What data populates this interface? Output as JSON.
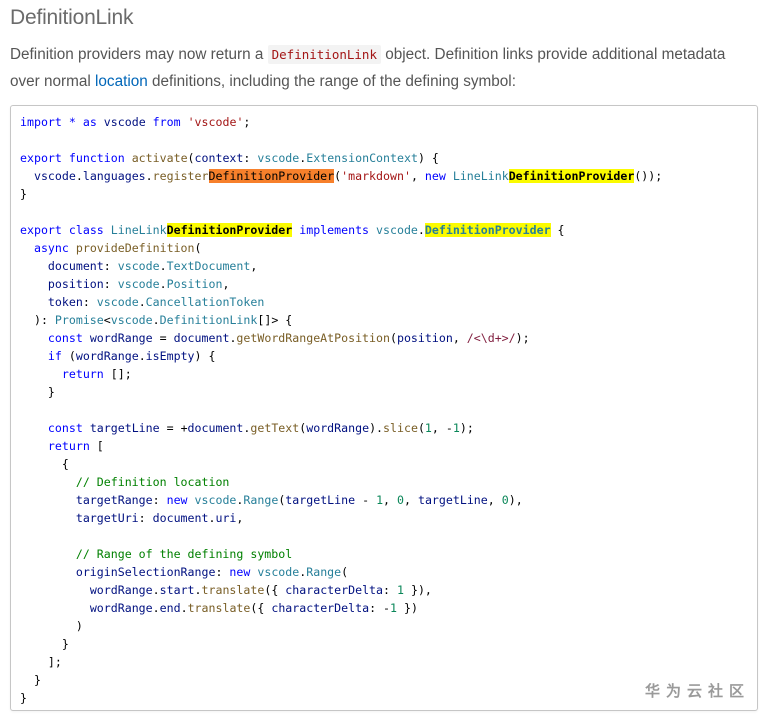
{
  "heading": "DefinitionLink",
  "intro": {
    "part1": "Definition providers may now return a ",
    "code": "DefinitionLink",
    "part2": " object. Definition links provide additional metadata over normal ",
    "link": "location",
    "part3": " definitions, including the range of the defining symbol:"
  },
  "code_lines": [
    [
      [
        "kw",
        "import"
      ],
      [
        "p",
        " "
      ],
      [
        "kw",
        "*"
      ],
      [
        "p",
        " "
      ],
      [
        "kw",
        "as"
      ],
      [
        "p",
        " "
      ],
      [
        "var",
        "vscode"
      ],
      [
        "p",
        " "
      ],
      [
        "kw",
        "from"
      ],
      [
        "p",
        " "
      ],
      [
        "str",
        "'vscode'"
      ],
      [
        "p",
        ";"
      ]
    ],
    [],
    [
      [
        "kw",
        "export"
      ],
      [
        "p",
        " "
      ],
      [
        "kw",
        "function"
      ],
      [
        "p",
        " "
      ],
      [
        "fn",
        "activate"
      ],
      [
        "p",
        "("
      ],
      [
        "var",
        "context"
      ],
      [
        "p",
        ": "
      ],
      [
        "ty",
        "vscode"
      ],
      [
        "p",
        "."
      ],
      [
        "ty",
        "ExtensionContext"
      ],
      [
        "p",
        ") {"
      ]
    ],
    [
      [
        "p",
        "  "
      ],
      [
        "var",
        "vscode"
      ],
      [
        "p",
        "."
      ],
      [
        "var",
        "languages"
      ],
      [
        "p",
        "."
      ],
      [
        "fn",
        "register"
      ],
      [
        "hl-o",
        "DefinitionProvider"
      ],
      [
        "p",
        "("
      ],
      [
        "str",
        "'markdown'"
      ],
      [
        "p",
        ", "
      ],
      [
        "kw",
        "new"
      ],
      [
        "p",
        " "
      ],
      [
        "ty",
        "LineLink"
      ],
      [
        "hl-y",
        "DefinitionProvider"
      ],
      [
        "p",
        "());"
      ]
    ],
    [
      [
        "p",
        "}"
      ]
    ],
    [],
    [
      [
        "kw",
        "export"
      ],
      [
        "p",
        " "
      ],
      [
        "kw",
        "class"
      ],
      [
        "p",
        " "
      ],
      [
        "ty",
        "LineLink"
      ],
      [
        "hl-y",
        "DefinitionProvider"
      ],
      [
        "p",
        " "
      ],
      [
        "kw",
        "implements"
      ],
      [
        "p",
        " "
      ],
      [
        "ty",
        "vscode"
      ],
      [
        "p",
        "."
      ],
      [
        "hl-ty",
        "DefinitionProvider"
      ],
      [
        "p",
        " {"
      ]
    ],
    [
      [
        "p",
        "  "
      ],
      [
        "kw",
        "async"
      ],
      [
        "p",
        " "
      ],
      [
        "fn",
        "provideDefinition"
      ],
      [
        "p",
        "("
      ]
    ],
    [
      [
        "p",
        "    "
      ],
      [
        "var",
        "document"
      ],
      [
        "p",
        ": "
      ],
      [
        "ty",
        "vscode"
      ],
      [
        "p",
        "."
      ],
      [
        "ty",
        "TextDocument"
      ],
      [
        "p",
        ","
      ]
    ],
    [
      [
        "p",
        "    "
      ],
      [
        "var",
        "position"
      ],
      [
        "p",
        ": "
      ],
      [
        "ty",
        "vscode"
      ],
      [
        "p",
        "."
      ],
      [
        "ty",
        "Position"
      ],
      [
        "p",
        ","
      ]
    ],
    [
      [
        "p",
        "    "
      ],
      [
        "var",
        "token"
      ],
      [
        "p",
        ": "
      ],
      [
        "ty",
        "vscode"
      ],
      [
        "p",
        "."
      ],
      [
        "ty",
        "CancellationToken"
      ]
    ],
    [
      [
        "p",
        "  ): "
      ],
      [
        "ty",
        "Promise"
      ],
      [
        "p",
        "<"
      ],
      [
        "ty",
        "vscode"
      ],
      [
        "p",
        "."
      ],
      [
        "ty",
        "DefinitionLink"
      ],
      [
        "p",
        "[]> {"
      ]
    ],
    [
      [
        "p",
        "    "
      ],
      [
        "kw",
        "const"
      ],
      [
        "p",
        " "
      ],
      [
        "var",
        "wordRange"
      ],
      [
        "p",
        " = "
      ],
      [
        "var",
        "document"
      ],
      [
        "p",
        "."
      ],
      [
        "fn",
        "getWordRangeAtPosition"
      ],
      [
        "p",
        "("
      ],
      [
        "var",
        "position"
      ],
      [
        "p",
        ", "
      ],
      [
        "re",
        "/<\\d+>/"
      ],
      [
        "p",
        ");"
      ]
    ],
    [
      [
        "p",
        "    "
      ],
      [
        "kw",
        "if"
      ],
      [
        "p",
        " ("
      ],
      [
        "var",
        "wordRange"
      ],
      [
        "p",
        "."
      ],
      [
        "var",
        "isEmpty"
      ],
      [
        "p",
        ") {"
      ]
    ],
    [
      [
        "p",
        "      "
      ],
      [
        "kw",
        "return"
      ],
      [
        "p",
        " [];"
      ]
    ],
    [
      [
        "p",
        "    }"
      ]
    ],
    [],
    [
      [
        "p",
        "    "
      ],
      [
        "kw",
        "const"
      ],
      [
        "p",
        " "
      ],
      [
        "var",
        "targetLine"
      ],
      [
        "p",
        " = +"
      ],
      [
        "var",
        "document"
      ],
      [
        "p",
        "."
      ],
      [
        "fn",
        "getText"
      ],
      [
        "p",
        "("
      ],
      [
        "var",
        "wordRange"
      ],
      [
        "p",
        ")."
      ],
      [
        "fn",
        "slice"
      ],
      [
        "p",
        "("
      ],
      [
        "num",
        "1"
      ],
      [
        "p",
        ", -"
      ],
      [
        "num",
        "1"
      ],
      [
        "p",
        ");"
      ]
    ],
    [
      [
        "p",
        "    "
      ],
      [
        "kw",
        "return"
      ],
      [
        "p",
        " ["
      ]
    ],
    [
      [
        "p",
        "      {"
      ]
    ],
    [
      [
        "p",
        "        "
      ],
      [
        "cm",
        "// Definition location"
      ]
    ],
    [
      [
        "p",
        "        "
      ],
      [
        "var",
        "targetRange"
      ],
      [
        "p",
        ": "
      ],
      [
        "kw",
        "new"
      ],
      [
        "p",
        " "
      ],
      [
        "ty",
        "vscode"
      ],
      [
        "p",
        "."
      ],
      [
        "ty",
        "Range"
      ],
      [
        "p",
        "("
      ],
      [
        "var",
        "targetLine"
      ],
      [
        "p",
        " - "
      ],
      [
        "num",
        "1"
      ],
      [
        "p",
        ", "
      ],
      [
        "num",
        "0"
      ],
      [
        "p",
        ", "
      ],
      [
        "var",
        "targetLine"
      ],
      [
        "p",
        ", "
      ],
      [
        "num",
        "0"
      ],
      [
        "p",
        "),"
      ]
    ],
    [
      [
        "p",
        "        "
      ],
      [
        "var",
        "targetUri"
      ],
      [
        "p",
        ": "
      ],
      [
        "var",
        "document"
      ],
      [
        "p",
        "."
      ],
      [
        "var",
        "uri"
      ],
      [
        "p",
        ","
      ]
    ],
    [],
    [
      [
        "p",
        "        "
      ],
      [
        "cm",
        "// Range of the defining symbol"
      ]
    ],
    [
      [
        "p",
        "        "
      ],
      [
        "var",
        "originSelectionRange"
      ],
      [
        "p",
        ": "
      ],
      [
        "kw",
        "new"
      ],
      [
        "p",
        " "
      ],
      [
        "ty",
        "vscode"
      ],
      [
        "p",
        "."
      ],
      [
        "ty",
        "Range"
      ],
      [
        "p",
        "("
      ]
    ],
    [
      [
        "p",
        "          "
      ],
      [
        "var",
        "wordRange"
      ],
      [
        "p",
        "."
      ],
      [
        "var",
        "start"
      ],
      [
        "p",
        "."
      ],
      [
        "fn",
        "translate"
      ],
      [
        "p",
        "({ "
      ],
      [
        "var",
        "characterDelta"
      ],
      [
        "p",
        ": "
      ],
      [
        "num",
        "1"
      ],
      [
        "p",
        " }),"
      ]
    ],
    [
      [
        "p",
        "          "
      ],
      [
        "var",
        "wordRange"
      ],
      [
        "p",
        "."
      ],
      [
        "var",
        "end"
      ],
      [
        "p",
        "."
      ],
      [
        "fn",
        "translate"
      ],
      [
        "p",
        "({ "
      ],
      [
        "var",
        "characterDelta"
      ],
      [
        "p",
        ": -"
      ],
      [
        "num",
        "1"
      ],
      [
        "p",
        " })"
      ]
    ],
    [
      [
        "p",
        "        )"
      ]
    ],
    [
      [
        "p",
        "      }"
      ]
    ],
    [
      [
        "p",
        "    ];"
      ]
    ],
    [
      [
        "p",
        "  }"
      ]
    ],
    [
      [
        "p",
        "}"
      ]
    ]
  ],
  "watermark": "华为云社区"
}
